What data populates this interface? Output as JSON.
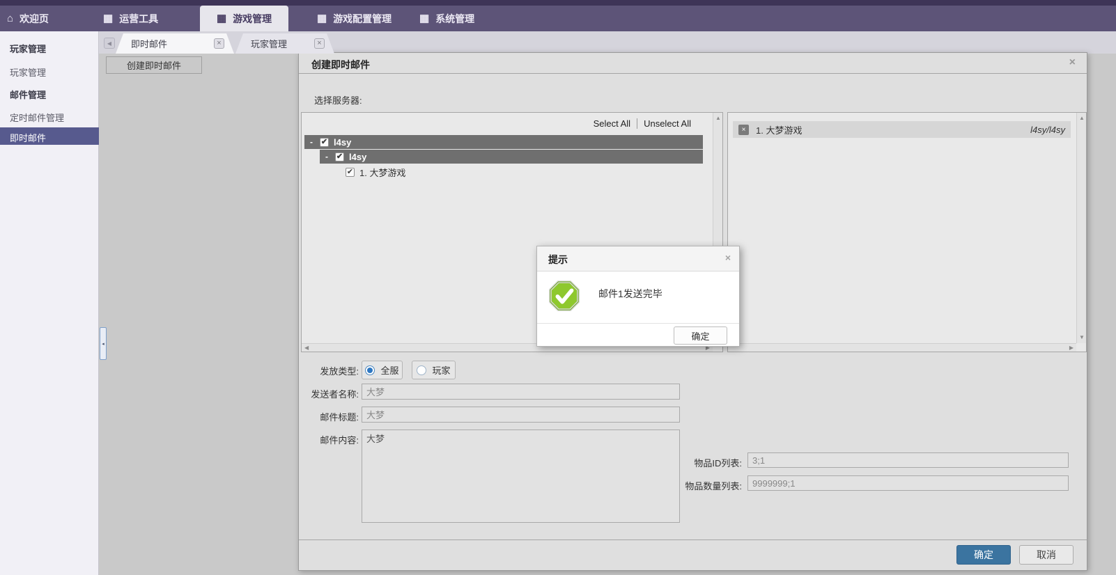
{
  "icons": {
    "home": "⌂",
    "module": "▦",
    "close": "×",
    "check": "✔",
    "scroll_up": "▲",
    "scroll_down": "▼",
    "scroll_left": "◀",
    "scroll_right": "▶",
    "collapse": "◂"
  },
  "colors": {
    "nav_bg": "#5d5478",
    "nav_top_strip": "#3e3457",
    "nav_active_bg": "#e7e6ec",
    "sidebar_selected_bg": "#575a8e",
    "content_bg": "#c9c9c9",
    "tree_bar_bg": "#6f6f6f",
    "primary_button_bg": "#3b74a0",
    "success_green": "#8ec82e"
  },
  "topnav": {
    "items": [
      {
        "label": "欢迎页"
      },
      {
        "label": "运营工具"
      },
      {
        "label": "游戏管理"
      },
      {
        "label": "游戏配置管理"
      },
      {
        "label": "系统管理"
      }
    ]
  },
  "sidebar": {
    "sections": [
      {
        "header": "玩家管理",
        "items": [
          "玩家管理"
        ]
      },
      {
        "header": "邮件管理",
        "items": [
          "定时邮件管理",
          "即时邮件"
        ]
      }
    ]
  },
  "subtabs": {
    "tabs": [
      {
        "label": "即时邮件"
      },
      {
        "label": "玩家管理"
      }
    ]
  },
  "content": {
    "create_button": "创建即时邮件"
  },
  "dialog": {
    "title": "创建即时邮件",
    "server_label": "选择服务器:",
    "tree": {
      "select_all": "Select All",
      "unselect_all": "Unselect All",
      "nodes": [
        {
          "expander": "-",
          "label": "l4sy"
        },
        {
          "expander": "-",
          "label": "l4sy"
        },
        {
          "label": "1. 大梦游戏"
        }
      ]
    },
    "selected_items": [
      {
        "label": "1. 大梦游戏",
        "path": "l4sy/l4sy"
      }
    ],
    "form": {
      "type_label": "发放类型:",
      "type_options": [
        {
          "label": "全服",
          "selected": true
        },
        {
          "label": "玩家",
          "selected": false
        }
      ],
      "sender_label": "发送者名称:",
      "sender_value": "大梦",
      "title_label": "邮件标题:",
      "title_value": "大梦",
      "content_label": "邮件内容:",
      "content_value": "大梦",
      "item_id_label": "物品ID列表:",
      "item_id_value": "3;1",
      "item_count_label": "物品数量列表:",
      "item_count_value": "9999999;1"
    },
    "ok": "确定",
    "cancel": "取消"
  },
  "modal": {
    "title": "提示",
    "message": "邮件1发送完毕",
    "ok": "确定"
  }
}
